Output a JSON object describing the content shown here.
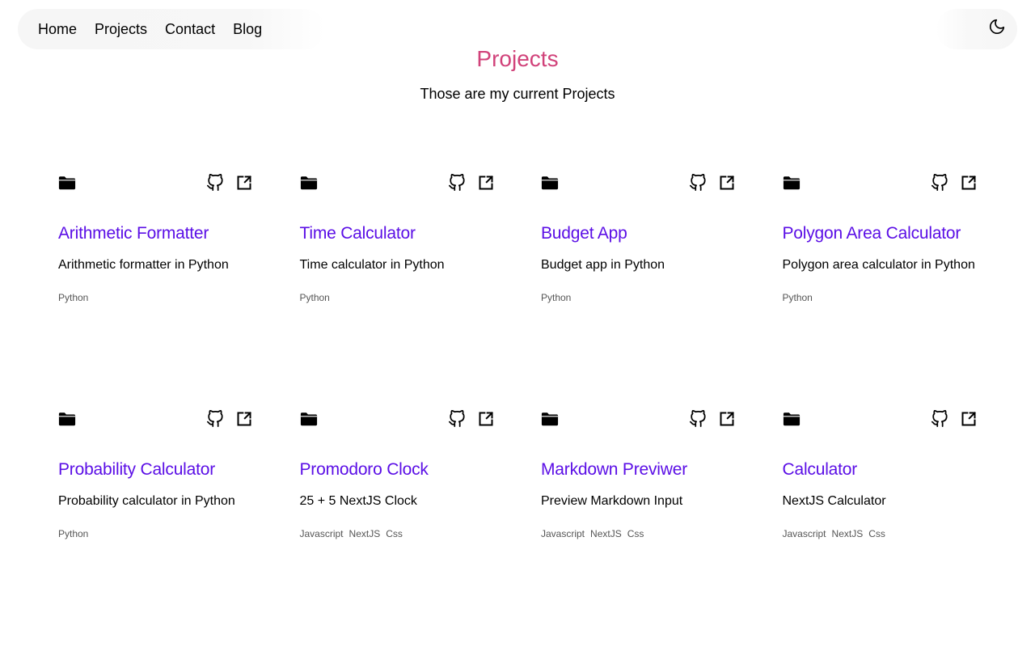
{
  "nav": {
    "items": [
      {
        "label": "Home"
      },
      {
        "label": "Projects"
      },
      {
        "label": "Contact"
      },
      {
        "label": "Blog"
      }
    ],
    "theme_toggle_icon": "moon-icon"
  },
  "header": {
    "title": "Projects",
    "subtitle": "Those are my current Projects",
    "title_color": "#d1427a"
  },
  "accent_color": "#5b0fe6",
  "projects": [
    {
      "title": "Arithmetic Formatter",
      "description": "Arithmetic formatter in Python",
      "tags": [
        "Python"
      ]
    },
    {
      "title": "Time Calculator",
      "description": "Time calculator in Python",
      "tags": [
        "Python"
      ]
    },
    {
      "title": "Budget App",
      "description": "Budget app in Python",
      "tags": [
        "Python"
      ]
    },
    {
      "title": "Polygon Area Calculator",
      "description": "Polygon area calculator in Python",
      "tags": [
        "Python"
      ]
    },
    {
      "title": "Probability Calculator",
      "description": "Probability calculator in Python",
      "tags": [
        "Python"
      ]
    },
    {
      "title": "Promodoro Clock",
      "description": "25 + 5 NextJS Clock",
      "tags": [
        "Javascript",
        "NextJS",
        "Css"
      ]
    },
    {
      "title": "Markdown Previwer",
      "description": "Preview Markdown Input",
      "tags": [
        "Javascript",
        "NextJS",
        "Css"
      ]
    },
    {
      "title": "Calculator",
      "description": "NextJS Calculator",
      "tags": [
        "Javascript",
        "NextJS",
        "Css"
      ]
    }
  ],
  "card_icons": {
    "folder": "folder-icon",
    "github": "github-icon",
    "external": "external-link-icon"
  }
}
